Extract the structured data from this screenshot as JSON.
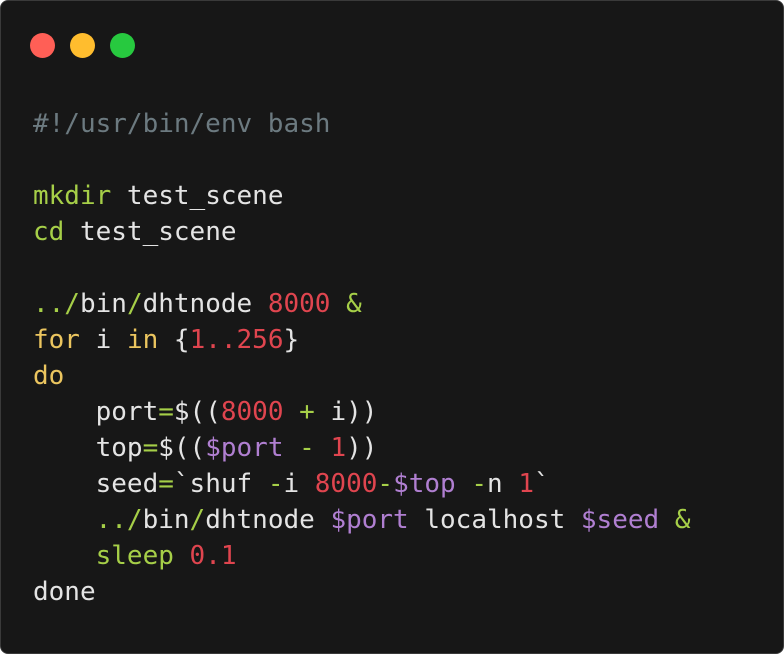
{
  "window": {
    "traffic_lights": [
      {
        "name": "close",
        "color": "#ff5f56"
      },
      {
        "name": "minimize",
        "color": "#ffbd2e"
      },
      {
        "name": "zoom",
        "color": "#27c93f"
      }
    ]
  },
  "code": {
    "lines": [
      [
        {
          "t": "#!/usr/bin/env bash",
          "c": "comment"
        }
      ],
      [],
      [
        {
          "t": "mkdir",
          "c": "cmd"
        },
        {
          "t": " test_scene",
          "c": "text"
        }
      ],
      [
        {
          "t": "cd",
          "c": "cmd"
        },
        {
          "t": " test_scene",
          "c": "text"
        }
      ],
      [],
      [
        {
          "t": "../",
          "c": "cmd"
        },
        {
          "t": "bin",
          "c": "text"
        },
        {
          "t": "/",
          "c": "cmd"
        },
        {
          "t": "dhtnode ",
          "c": "text"
        },
        {
          "t": "8000",
          "c": "num"
        },
        {
          "t": " ",
          "c": "text"
        },
        {
          "t": "&",
          "c": "op"
        }
      ],
      [
        {
          "t": "for",
          "c": "kw"
        },
        {
          "t": " i ",
          "c": "text"
        },
        {
          "t": "in",
          "c": "kw"
        },
        {
          "t": " {",
          "c": "punc"
        },
        {
          "t": "1..256",
          "c": "num"
        },
        {
          "t": "}",
          "c": "punc"
        }
      ],
      [
        {
          "t": "do",
          "c": "kw"
        }
      ],
      [
        {
          "t": "    port",
          "c": "text"
        },
        {
          "t": "=",
          "c": "op"
        },
        {
          "t": "$((",
          "c": "punc"
        },
        {
          "t": "8000",
          "c": "num"
        },
        {
          "t": " ",
          "c": "text"
        },
        {
          "t": "+",
          "c": "op"
        },
        {
          "t": " i))",
          "c": "text"
        }
      ],
      [
        {
          "t": "    top",
          "c": "text"
        },
        {
          "t": "=",
          "c": "op"
        },
        {
          "t": "$((",
          "c": "punc"
        },
        {
          "t": "$port",
          "c": "var"
        },
        {
          "t": " ",
          "c": "text"
        },
        {
          "t": "-",
          "c": "op"
        },
        {
          "t": " ",
          "c": "text"
        },
        {
          "t": "1",
          "c": "num"
        },
        {
          "t": "))",
          "c": "punc"
        }
      ],
      [
        {
          "t": "    seed",
          "c": "text"
        },
        {
          "t": "=",
          "c": "op"
        },
        {
          "t": "`shuf ",
          "c": "text"
        },
        {
          "t": "-",
          "c": "op"
        },
        {
          "t": "i ",
          "c": "text"
        },
        {
          "t": "8000",
          "c": "num"
        },
        {
          "t": "-",
          "c": "op"
        },
        {
          "t": "$top",
          "c": "var"
        },
        {
          "t": " ",
          "c": "text"
        },
        {
          "t": "-",
          "c": "op"
        },
        {
          "t": "n ",
          "c": "text"
        },
        {
          "t": "1",
          "c": "num"
        },
        {
          "t": "`",
          "c": "text"
        }
      ],
      [
        {
          "t": "    ../",
          "c": "cmd"
        },
        {
          "t": "bin",
          "c": "text"
        },
        {
          "t": "/",
          "c": "cmd"
        },
        {
          "t": "dhtnode ",
          "c": "text"
        },
        {
          "t": "$port",
          "c": "var"
        },
        {
          "t": " localhost ",
          "c": "text"
        },
        {
          "t": "$seed",
          "c": "var"
        },
        {
          "t": " ",
          "c": "text"
        },
        {
          "t": "&",
          "c": "op"
        }
      ],
      [
        {
          "t": "    sleep",
          "c": "cmd"
        },
        {
          "t": " ",
          "c": "text"
        },
        {
          "t": "0.1",
          "c": "num"
        }
      ],
      [
        {
          "t": "done",
          "c": "text"
        }
      ]
    ]
  }
}
